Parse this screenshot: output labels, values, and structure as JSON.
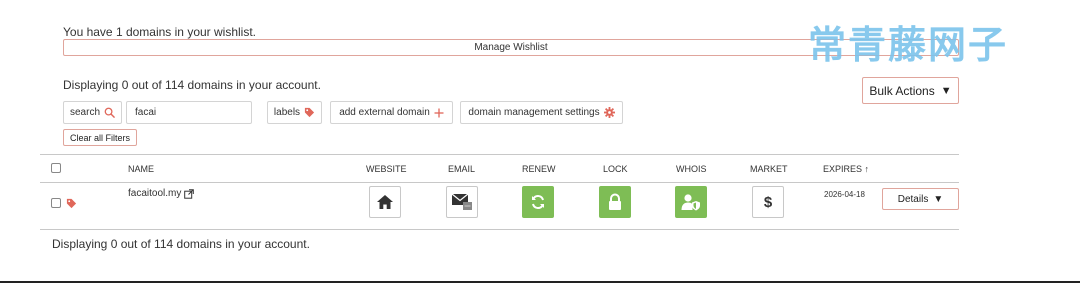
{
  "wishlist": {
    "text": "You have 1 domains in your wishlist.",
    "manage_label": "Manage Wishlist"
  },
  "watermark": "常青藤网子",
  "summary": {
    "top": "Displaying 0 out of 114 domains in your account.",
    "bottom": "Displaying 0 out of 114 domains in your account."
  },
  "bulk_actions": {
    "label": "Bulk Actions",
    "caret": "▼"
  },
  "filters": {
    "search_label": "search",
    "search_value": "facai",
    "labels_label": "labels",
    "external_label": "add external domain",
    "settings_label": "domain management settings",
    "clear_label": "Clear all Filters"
  },
  "table": {
    "headers": {
      "name": "NAME",
      "website": "WEBSITE",
      "email": "EMAIL",
      "renew": "RENEW",
      "lock": "LOCK",
      "whois": "WHOIS",
      "market": "MARKET",
      "expires": "EXPIRES",
      "expires_sort": "↑"
    },
    "rows": [
      {
        "domain": "facaitool.my",
        "expires": "2026-04-18",
        "details_label": "Details",
        "details_caret": "▼",
        "market_symbol": "$"
      }
    ]
  },
  "colors": {
    "accent": "#e0675a",
    "green": "#7ebd55",
    "watermark": "#7cc4ec"
  },
  "icons": [
    "search-icon",
    "tag-icon",
    "plus-icon",
    "gear-icon",
    "external-link-icon",
    "home-icon",
    "envelope-icon",
    "refresh-icon",
    "lock-icon",
    "user-shield-icon",
    "dollar-icon"
  ]
}
